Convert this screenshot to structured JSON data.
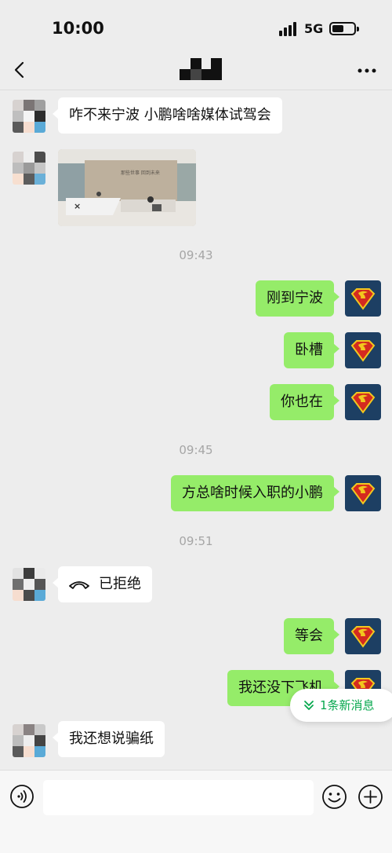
{
  "status_bar": {
    "time": "10:00",
    "network": "5G"
  },
  "header": {
    "back_icon": "chevron-left-icon",
    "more_icon": "more-icon"
  },
  "messages": [
    {
      "side": "left",
      "type": "text",
      "text": "咋不来宁波 小鹏啥啥媒体试驾会"
    },
    {
      "side": "left",
      "type": "image",
      "image_text": [
        "那些世事 回到未来"
      ]
    },
    {
      "type": "time",
      "text": "09:43"
    },
    {
      "side": "right",
      "type": "text",
      "text": "刚到宁波"
    },
    {
      "side": "right",
      "type": "text",
      "text": "卧槽"
    },
    {
      "side": "right",
      "type": "text",
      "text": "你也在"
    },
    {
      "type": "time",
      "text": "09:45"
    },
    {
      "side": "right",
      "type": "text",
      "text": "方总啥时候入职的小鹏"
    },
    {
      "type": "time",
      "text": "09:51"
    },
    {
      "side": "left",
      "type": "call",
      "text": "已拒绝",
      "icon": "phone-declined-icon"
    },
    {
      "side": "right",
      "type": "text",
      "text": "等会"
    },
    {
      "side": "right",
      "type": "text",
      "text": "我还没下飞机"
    },
    {
      "side": "left",
      "type": "text",
      "text": "我还想说骗纸"
    }
  ],
  "new_message_badge": {
    "text": "1条新消息",
    "icon": "double-chevron-down-icon"
  },
  "input_bar": {
    "voice_icon": "voice-icon",
    "input_value": "",
    "emoji_icon": "emoji-icon",
    "plus_icon": "plus-icon"
  },
  "colors": {
    "bubble_right": "#95ec69",
    "bubble_left": "#ffffff",
    "accent": "#07a84e",
    "background": "#ededed"
  }
}
